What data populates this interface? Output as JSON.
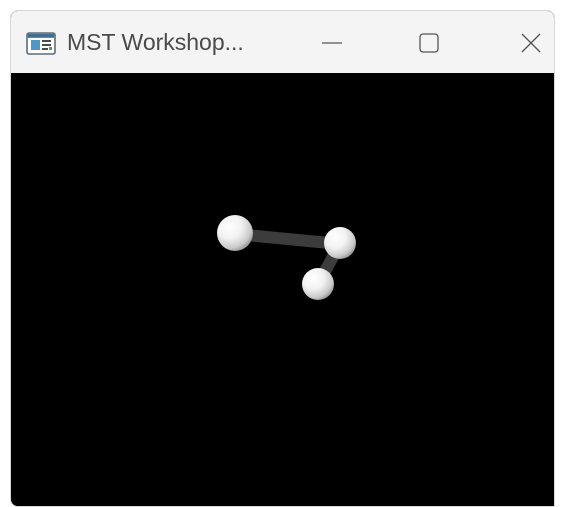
{
  "window": {
    "title": "MST Workshop...",
    "app_icon": "application-window-icon",
    "controls": {
      "minimize_icon": "minimize-icon",
      "maximize_icon": "maximize-icon",
      "close_icon": "close-icon"
    }
  },
  "viewport": {
    "background_color": "#000000",
    "scene": {
      "atoms": [
        {
          "name": "atom-1",
          "color": "#ffffff"
        },
        {
          "name": "atom-2",
          "color": "#ffffff"
        },
        {
          "name": "atom-3",
          "color": "#ffffff"
        }
      ],
      "bonds": [
        {
          "from": "atom-1",
          "to": "atom-2",
          "color": "#3c3c3c"
        },
        {
          "from": "atom-2",
          "to": "atom-3",
          "color": "#3c3c3c"
        }
      ]
    }
  }
}
